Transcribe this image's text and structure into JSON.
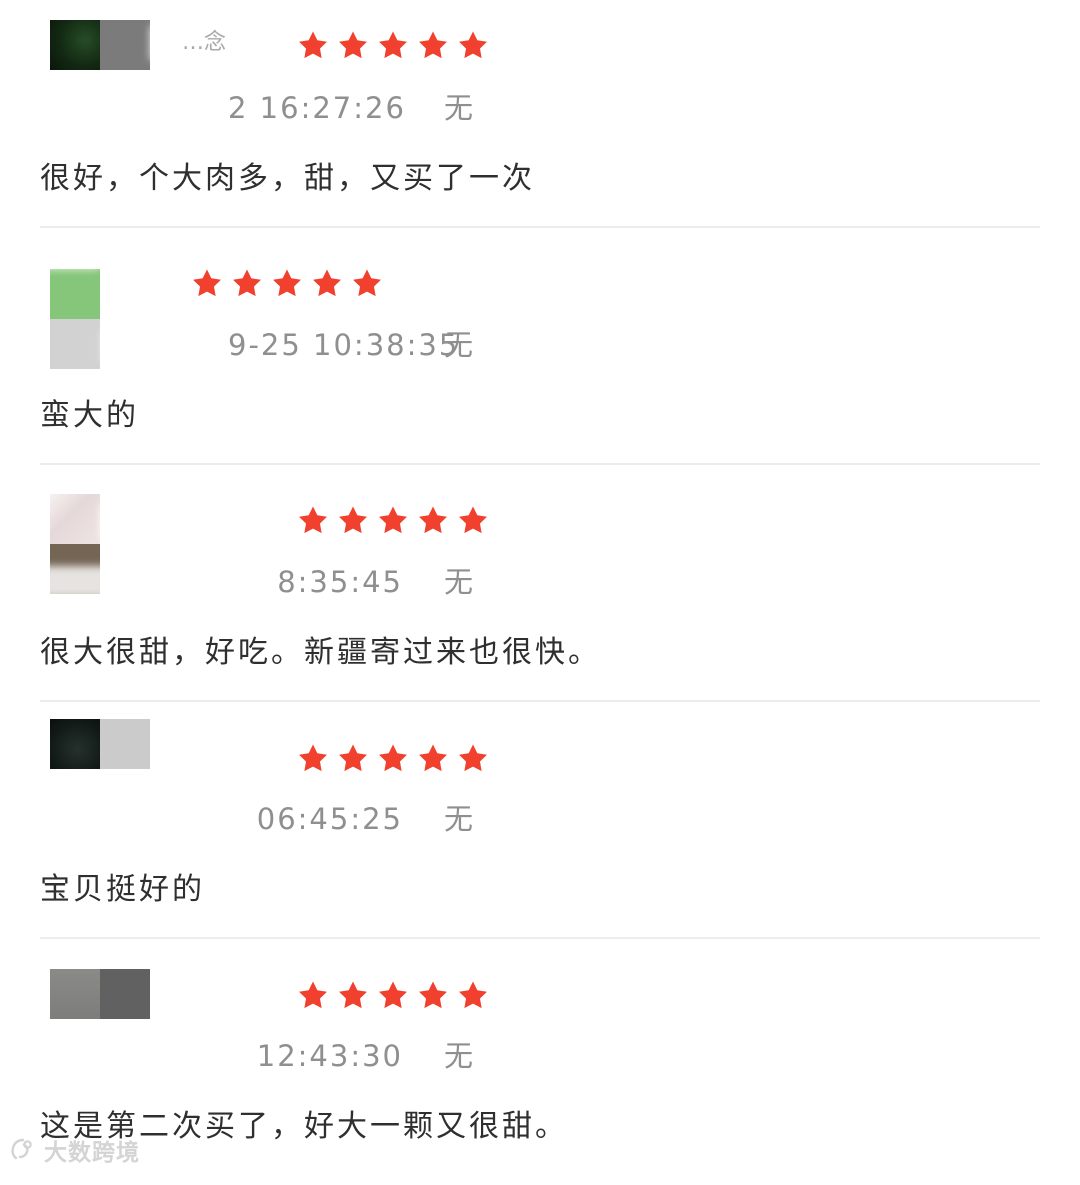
{
  "reviews": [
    {
      "author": "…念",
      "rating": 5,
      "timestamp": "2 16:27:26",
      "dimension": "无",
      "text": "很好，个大肉多，甜，又买了一次",
      "avatar_colors": [
        "#173117",
        "#7b7b7b"
      ]
    },
    {
      "author": "",
      "rating": 5,
      "timestamp": "9-25 10:38:35",
      "dimension": "无",
      "text": "蛮大的",
      "avatar_colors": [
        "#86c67a",
        "#d2d2d2"
      ]
    },
    {
      "author": "",
      "rating": 5,
      "timestamp": "8:35:45",
      "dimension": "无",
      "text": "很大很甜，好吃。新疆寄过来也很快。",
      "avatar_colors": [
        "#efe5e5",
        "#746554"
      ]
    },
    {
      "author": "",
      "rating": 5,
      "timestamp": "06:45:25",
      "dimension": "无",
      "text": "宝贝挺好的",
      "avatar_colors": [
        "#111c19",
        "#cbcbcb"
      ]
    },
    {
      "author": "",
      "rating": 5,
      "timestamp": "12:43:30",
      "dimension": "无",
      "text": "这是第二次买了，好大一颗又很甜。",
      "avatar_colors": [
        "#7d7d7b",
        "#616161"
      ]
    }
  ],
  "watermark": {
    "text": "大数跨境"
  },
  "colors": {
    "star": "#f1402d",
    "muted_text": "#8f8f8f",
    "comment_text": "#2f2f2f",
    "divider": "#ececec"
  }
}
